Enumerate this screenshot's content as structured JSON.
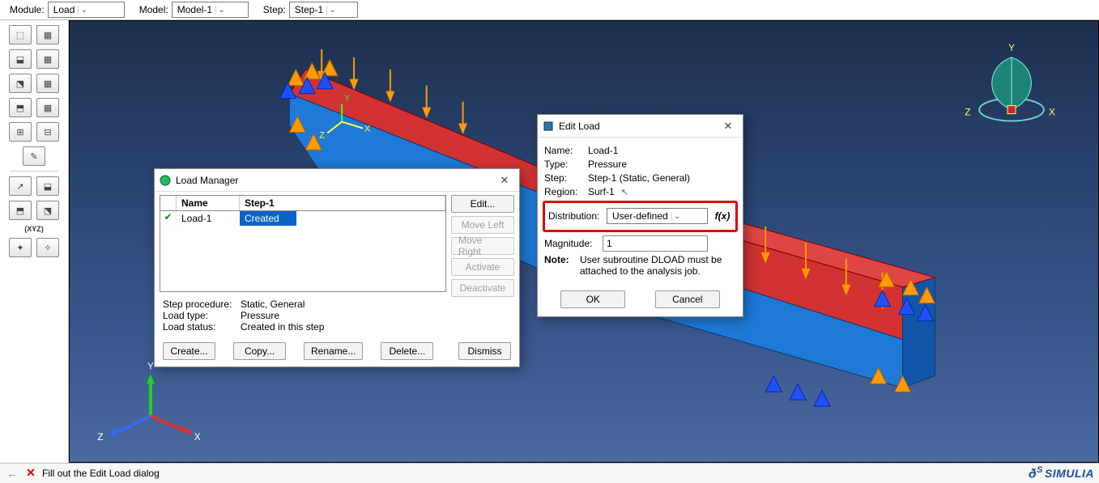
{
  "topbar": {
    "module_label": "Module:",
    "module_value": "Load",
    "model_label": "Model:",
    "model_value": "Model-1",
    "step_label": "Step:",
    "step_value": "Step-1"
  },
  "status": {
    "message": "Fill out the Edit Load dialog",
    "brand": "SIMULIA"
  },
  "load_manager": {
    "title": "Load Manager",
    "col_name": "Name",
    "col_step": "Step-1",
    "row_name": "Load-1",
    "row_status": "Created",
    "edit": "Edit...",
    "move_left": "Move Left",
    "move_right": "Move Right",
    "activate": "Activate",
    "deactivate": "Deactivate",
    "step_proc_k": "Step procedure:",
    "step_proc_v": "Static, General",
    "load_type_k": "Load type:",
    "load_type_v": "Pressure",
    "load_status_k": "Load status:",
    "load_status_v": "Created in this step",
    "create": "Create...",
    "copy": "Copy...",
    "rename": "Rename...",
    "delete": "Delete...",
    "dismiss": "Dismiss"
  },
  "edit_load": {
    "title": "Edit Load",
    "name_k": "Name:",
    "name_v": "Load-1",
    "type_k": "Type:",
    "type_v": "Pressure",
    "step_k": "Step:",
    "step_v": "Step-1 (Static, General)",
    "region_k": "Region:",
    "region_v": "Surf-1",
    "dist_k": "Distribution:",
    "dist_v": "User-defined",
    "fx": "f(x)",
    "mag_k": "Magnitude:",
    "mag_v": "1",
    "note_k": "Note:",
    "note_v": "User subroutine DLOAD must be attached to the analysis job.",
    "ok": "OK",
    "cancel": "Cancel"
  },
  "viewport": {
    "triad": {
      "x": "X",
      "y": "Y",
      "z": "Z"
    },
    "compass": {
      "x": "X",
      "y": "Y",
      "z": "Z"
    }
  },
  "tool_groups": {
    "xyz": "(XYZ)"
  }
}
